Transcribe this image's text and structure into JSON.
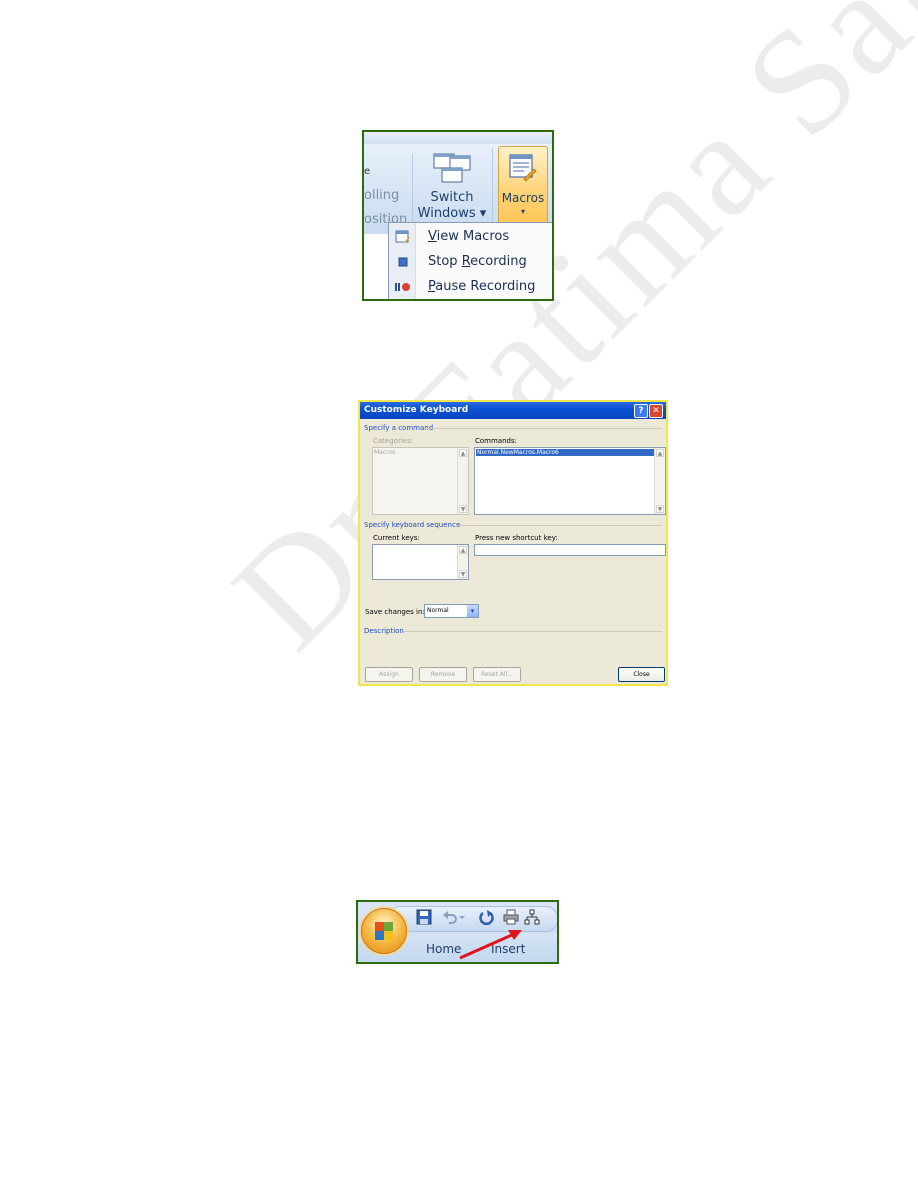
{
  "watermark": "Dr. Fatima Salim",
  "macros_ribbon": {
    "partial_text_top": "e",
    "partial_label_1": "olling",
    "partial_label_2": "osition",
    "switch_windows_line1": "Switch",
    "switch_windows_line2": "Windows ▾",
    "macros_label": "Macros",
    "macros_arrow": "▾",
    "menu_items": [
      {
        "prefix": "",
        "accel": "V",
        "suffix": "iew Macros",
        "icon": "view-macros-icon"
      },
      {
        "prefix": "Stop ",
        "accel": "R",
        "suffix": "ecording",
        "icon": "stop-icon"
      },
      {
        "prefix": "",
        "accel": "P",
        "suffix": "ause Recording",
        "icon": "pause-record-icon"
      }
    ]
  },
  "customize_keyboard": {
    "title": "Customize Keyboard",
    "help_glyph": "?",
    "close_glyph": "✕",
    "section_command": "Specify a command",
    "categories_label": "Categories:",
    "categories_items": [
      "Macros"
    ],
    "commands_label": "Commands:",
    "commands_items": [
      "Normal.NewMacros.Macro6"
    ],
    "section_keyboard": "Specify keyboard sequence",
    "current_keys_label": "Current keys:",
    "press_shortcut_label": "Press new shortcut key:",
    "save_changes_label": "Save changes in:",
    "save_changes_value": "Normal",
    "section_description": "Description",
    "buttons": {
      "assign": "Assign",
      "remove": "Remove",
      "reset_all": "Reset All...",
      "close": "Close"
    }
  },
  "quick_access": {
    "tabs": [
      "Home",
      "Insert"
    ],
    "icons": [
      "office-button-icon",
      "save-icon",
      "undo-icon",
      "redo-icon",
      "print-icon",
      "structure-icon"
    ]
  }
}
